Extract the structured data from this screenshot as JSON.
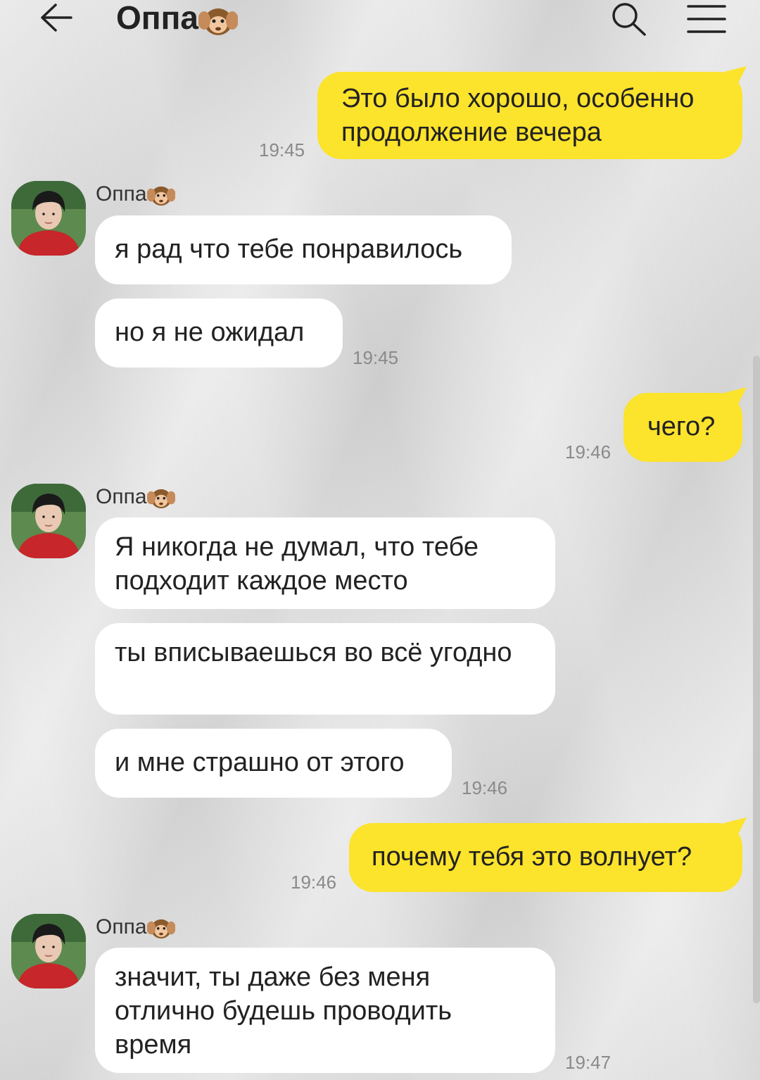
{
  "header": {
    "title": "Оппа",
    "title_emoji": "hear-no-evil-monkey",
    "back_icon": "arrow-left-icon",
    "search_icon": "search-icon",
    "menu_icon": "hamburger-menu-icon"
  },
  "colors": {
    "outgoing": "#fce32c",
    "incoming": "#ffffff",
    "time": "#8a8a8a"
  },
  "messages": [
    {
      "dir": "out",
      "text": "Это было хорошо, особенно продолжение вечера",
      "time": "19:45"
    },
    {
      "dir": "in",
      "sender": "Оппа",
      "text": "я рад что тебе понравилось"
    },
    {
      "dir": "in",
      "text": "но я не ожидал",
      "time": "19:45"
    },
    {
      "dir": "out",
      "text": "чего?",
      "time": "19:46"
    },
    {
      "dir": "in",
      "sender": "Оппа",
      "text": "Я никогда не думал, что тебе подходит каждое место"
    },
    {
      "dir": "in",
      "text": "ты вписываешься во всё угодно"
    },
    {
      "dir": "in",
      "text": "и мне страшно от этого",
      "time": "19:46"
    },
    {
      "dir": "out",
      "text": "почему тебя это волнует?",
      "time": "19:46"
    },
    {
      "dir": "in",
      "sender": "Оппа",
      "text": "значит, ты даже без меня отлично будешь проводить время",
      "time": "19:47"
    }
  ]
}
